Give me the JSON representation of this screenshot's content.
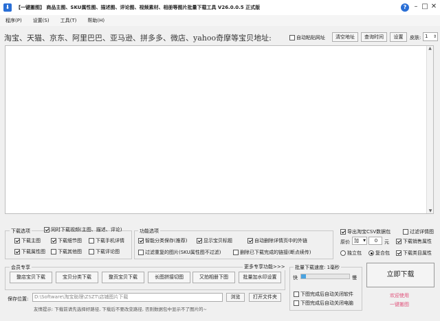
{
  "title": "【一键搬图】 商品主图、SKU属性图、描述图、评论图、视频素材、相册等图片批量下载工具 V26.0.0.5 正式版",
  "icons": {
    "app": "app-logo-icon",
    "help": "help-icon",
    "minimize": "minimize-icon",
    "maximize": "maximize-icon",
    "close": "close-icon"
  },
  "accent": "#2a6fd6",
  "link_color": "#e0507a",
  "menu": [
    "程序(P)",
    "设置(S)",
    "工具(T)",
    "帮助(H)"
  ],
  "url_bar": {
    "label": "淘宝、天猫、京东、阿里巴巴、亚马逊、拼多多、微店、yahoo奇摩等宝贝地址:",
    "auto_paste": "自动粘贴网址",
    "clear": "清空地址",
    "query_time": "查询时间",
    "settings": "设置",
    "skin_label": "皮肤:",
    "skin_value": "1"
  },
  "download_options": {
    "title": "下载选项",
    "sync_video": "同时下载视频(主图、描述、评论)",
    "main": "下载主图",
    "detail": "下载细节图",
    "mobile_detail": "下载手机详情",
    "attr": "下载属性图",
    "other": "下载其他图",
    "comment": "下载评论图"
  },
  "function_options": {
    "title": "功能选项",
    "smart_save": "智能分类保存(推荐)",
    "show_title": "显示宝贝标题",
    "auto_delete_outer": "自动删除详情页中的外链",
    "filter_dup": "过滤重复的图片(SKU属性图不过滤)",
    "delete_done": "删除已下载完成的链接(断点续传)"
  },
  "right_options": {
    "export_csv": "导出淘宝CSV数据包",
    "filter_detail": "过滤详情图",
    "price_label": "原价",
    "price_op": "加",
    "price_value": "0",
    "price_unit": "元",
    "sales_attr": "下载销售属性",
    "independent": "独立包",
    "combined": "复合包",
    "category_attr": "下载类目属性"
  },
  "member": {
    "title": "会员专享",
    "more": "更多专享功能>>>",
    "buttons": [
      "整店宝贝下载",
      "宝贝分类下载",
      "整页宝贝下载",
      "长图拼接切图",
      "又拍相册下图",
      "批量加水印设置"
    ]
  },
  "speed": {
    "title": "批量下载速度: 1毫秒",
    "fast": "快",
    "slow": "慢",
    "fill": 0.1,
    "close_software": "下图完成后自动关闭软件",
    "shutdown": "下图完成后自动关闭电脑"
  },
  "save": {
    "label": "保存位置:",
    "path": "D:\\Software\\淘宝助理\\ZSZT\\店铺图片下载",
    "browse": "浏览",
    "open_folder": "打开文件夹"
  },
  "start_button": "立即下载",
  "welcome": "欢迎使用",
  "brand": "一键搬图",
  "tip": "友情提示: 下载前请先选择好路径, 下载后不要改变路径, 否则数据包中显示不了图片的~"
}
